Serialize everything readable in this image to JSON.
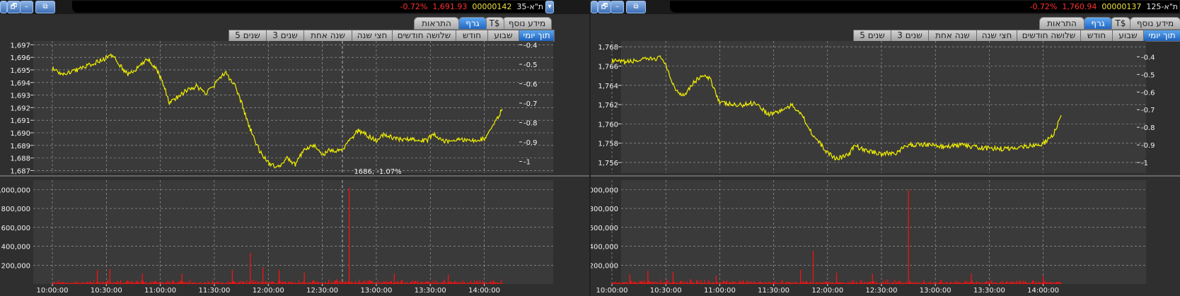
{
  "colors": {
    "line": "#f2f000",
    "volume": "#ff1010",
    "grid": "#a8a8a8",
    "activeTab": "#2f7fd8"
  },
  "panels": [
    {
      "window": {
        "minimize": "–",
        "restore": "🗗",
        "extra": "⯈"
      },
      "ticker": {
        "change": "-0.72%",
        "price": "1,691.93",
        "name": "ת\"א-35",
        "code": "00000142"
      },
      "tabs": [
        "מידע נוסף",
        "T$",
        "גרף",
        "התראות"
      ],
      "periods": [
        "תוך יומי",
        "שבוע",
        "חודש",
        "שלושה חודשים",
        "חצי שנה",
        "שנה אחת",
        "3 שנים",
        "5 שנים"
      ],
      "crosshair_label": "1686, -1.07%",
      "chart_data": {
        "type": "line",
        "x_ticks": [
          "10:00:00",
          "10:30:00",
          "11:00:00",
          "11:30:00",
          "12:00:00",
          "12:30:00",
          "13:00:00",
          "13:30:00",
          "14:00:00"
        ],
        "price_axis": {
          "ylim": [
            1686.8,
            1697.3
          ],
          "ticks": [
            "1,697",
            "1,696",
            "1,695",
            "1,694",
            "1,693",
            "1,692",
            "1,691",
            "1,690",
            "1,689",
            "1,688",
            "1,687"
          ]
        },
        "pct_axis": {
          "ylim": [
            -1.06,
            -0.38
          ],
          "ticks": [
            "-0.4",
            "-0.5",
            "-0.6",
            "-0.7",
            "-0.8",
            "-0.9",
            "-1"
          ]
        },
        "price_series": [
          {
            "t": "10:00",
            "v": 1695.1
          },
          {
            "t": "10:05",
            "v": 1694.6
          },
          {
            "t": "10:12",
            "v": 1694.9
          },
          {
            "t": "10:20",
            "v": 1695.4
          },
          {
            "t": "10:28",
            "v": 1695.8
          },
          {
            "t": "10:33",
            "v": 1696.2
          },
          {
            "t": "10:38",
            "v": 1695.3
          },
          {
            "t": "10:42",
            "v": 1694.6
          },
          {
            "t": "10:48",
            "v": 1695.2
          },
          {
            "t": "10:53",
            "v": 1695.9
          },
          {
            "t": "10:58",
            "v": 1695.0
          },
          {
            "t": "11:02",
            "v": 1693.8
          },
          {
            "t": "11:05",
            "v": 1692.3
          },
          {
            "t": "11:10",
            "v": 1692.9
          },
          {
            "t": "11:15",
            "v": 1693.4
          },
          {
            "t": "11:20",
            "v": 1693.7
          },
          {
            "t": "11:25",
            "v": 1693.1
          },
          {
            "t": "11:30",
            "v": 1693.8
          },
          {
            "t": "11:36",
            "v": 1694.8
          },
          {
            "t": "11:42",
            "v": 1693.6
          },
          {
            "t": "11:45",
            "v": 1692.4
          },
          {
            "t": "11:50",
            "v": 1690.3
          },
          {
            "t": "11:55",
            "v": 1688.6
          },
          {
            "t": "12:00",
            "v": 1687.6
          },
          {
            "t": "12:05",
            "v": 1687.2
          },
          {
            "t": "12:10",
            "v": 1688.0
          },
          {
            "t": "12:15",
            "v": 1687.5
          },
          {
            "t": "12:20",
            "v": 1688.7
          },
          {
            "t": "12:25",
            "v": 1689.1
          },
          {
            "t": "12:30",
            "v": 1688.2
          },
          {
            "t": "12:35",
            "v": 1688.7
          },
          {
            "t": "12:40",
            "v": 1688.5
          },
          {
            "t": "12:45",
            "v": 1689.3
          },
          {
            "t": "12:50",
            "v": 1690.2
          },
          {
            "t": "12:55",
            "v": 1689.8
          },
          {
            "t": "13:00",
            "v": 1689.4
          },
          {
            "t": "13:05",
            "v": 1689.9
          },
          {
            "t": "13:10",
            "v": 1689.5
          },
          {
            "t": "13:20",
            "v": 1689.5
          },
          {
            "t": "13:28",
            "v": 1689.4
          },
          {
            "t": "13:32",
            "v": 1689.9
          },
          {
            "t": "13:38",
            "v": 1689.3
          },
          {
            "t": "13:45",
            "v": 1689.4
          },
          {
            "t": "13:55",
            "v": 1689.4
          },
          {
            "t": "14:00",
            "v": 1689.5
          },
          {
            "t": "14:05",
            "v": 1690.5
          },
          {
            "t": "14:10",
            "v": 1691.9
          }
        ],
        "volume_axis": {
          "ylim": [
            0,
            1100000
          ],
          "ticks": [
            "1,000,000",
            "800,000",
            "600,000",
            "400,000",
            "200,000"
          ]
        },
        "volume_spikes": [
          {
            "t": "10:25",
            "v": 150000
          },
          {
            "t": "10:32",
            "v": 160000
          },
          {
            "t": "10:50",
            "v": 110000
          },
          {
            "t": "11:12",
            "v": 110000
          },
          {
            "t": "11:40",
            "v": 150000
          },
          {
            "t": "11:50",
            "v": 330000
          },
          {
            "t": "11:57",
            "v": 180000
          },
          {
            "t": "12:06",
            "v": 150000
          },
          {
            "t": "12:20",
            "v": 120000
          },
          {
            "t": "12:45",
            "v": 1020000
          },
          {
            "t": "13:10",
            "v": 110000
          },
          {
            "t": "13:40",
            "v": 100000
          }
        ]
      }
    },
    {
      "window": {
        "minimize": "–",
        "restore": "🗗",
        "extra": "⯈"
      },
      "ticker": {
        "change": "-0.72%",
        "price": "1,760.94",
        "name": "ת\"א-125",
        "code": "00000137"
      },
      "tabs": [
        "מידע נוסף",
        "T$",
        "גרף",
        "התראות"
      ],
      "periods": [
        "תוך יומי",
        "שבוע",
        "חודש",
        "שלושה חודשים",
        "חצי שנה",
        "שנה אחת",
        "3 שנים",
        "5 שנים"
      ],
      "crosshair_label": "",
      "chart_data": {
        "type": "line",
        "x_ticks": [
          "10:00:00",
          "10:30:00",
          "11:00:00",
          "11:30:00",
          "12:00:00",
          "12:30:00",
          "13:00:00",
          "13:30:00",
          "14:00:00"
        ],
        "price_axis": {
          "ylim": [
            1754.9,
            1768.6
          ],
          "ticks": [
            "1,768",
            "1,766",
            "1,764",
            "1,762",
            "1,760",
            "1,758",
            "1,756"
          ]
        },
        "pct_axis": {
          "ylim": [
            -1.06,
            -0.31
          ],
          "ticks": [
            "-0.4",
            "-0.5",
            "-0.6",
            "-0.7",
            "-0.8",
            "-0.9",
            "-1"
          ]
        },
        "price_series": [
          {
            "t": "10:00",
            "v": 1766.5
          },
          {
            "t": "10:08",
            "v": 1766.4
          },
          {
            "t": "10:15",
            "v": 1766.6
          },
          {
            "t": "10:25",
            "v": 1766.8
          },
          {
            "t": "10:28",
            "v": 1766.9
          },
          {
            "t": "10:32",
            "v": 1765.0
          },
          {
            "t": "10:36",
            "v": 1763.4
          },
          {
            "t": "10:40",
            "v": 1763.0
          },
          {
            "t": "10:45",
            "v": 1764.2
          },
          {
            "t": "10:50",
            "v": 1765.0
          },
          {
            "t": "10:55",
            "v": 1764.6
          },
          {
            "t": "11:00",
            "v": 1762.2
          },
          {
            "t": "11:10",
            "v": 1761.9
          },
          {
            "t": "11:20",
            "v": 1762.2
          },
          {
            "t": "11:27",
            "v": 1761.0
          },
          {
            "t": "11:33",
            "v": 1761.3
          },
          {
            "t": "11:40",
            "v": 1761.9
          },
          {
            "t": "11:45",
            "v": 1761.2
          },
          {
            "t": "11:52",
            "v": 1758.8
          },
          {
            "t": "12:00",
            "v": 1757.0
          },
          {
            "t": "12:05",
            "v": 1756.4
          },
          {
            "t": "12:12",
            "v": 1756.8
          },
          {
            "t": "12:15",
            "v": 1757.8
          },
          {
            "t": "12:20",
            "v": 1757.3
          },
          {
            "t": "12:30",
            "v": 1756.9
          },
          {
            "t": "12:38",
            "v": 1757.0
          },
          {
            "t": "12:45",
            "v": 1757.8
          },
          {
            "t": "12:55",
            "v": 1757.9
          },
          {
            "t": "13:05",
            "v": 1757.6
          },
          {
            "t": "13:15",
            "v": 1757.8
          },
          {
            "t": "13:25",
            "v": 1757.5
          },
          {
            "t": "13:40",
            "v": 1757.4
          },
          {
            "t": "13:50",
            "v": 1757.7
          },
          {
            "t": "14:00",
            "v": 1757.9
          },
          {
            "t": "14:06",
            "v": 1759.0
          },
          {
            "t": "14:10",
            "v": 1760.9
          }
        ],
        "volume_axis": {
          "ylim": [
            0,
            1100000
          ],
          "ticks": [
            "1,000,000",
            "800,000",
            "600,000",
            "400,000",
            "200,000"
          ]
        },
        "volume_spikes": [
          {
            "t": "10:10",
            "v": 100000
          },
          {
            "t": "10:20",
            "v": 140000
          },
          {
            "t": "10:34",
            "v": 130000
          },
          {
            "t": "10:58",
            "v": 90000
          },
          {
            "t": "11:45",
            "v": 150000
          },
          {
            "t": "11:52",
            "v": 350000
          },
          {
            "t": "12:05",
            "v": 120000
          },
          {
            "t": "12:25",
            "v": 110000
          },
          {
            "t": "12:45",
            "v": 1000000
          },
          {
            "t": "13:20",
            "v": 110000
          },
          {
            "t": "14:00",
            "v": 90000
          }
        ]
      }
    }
  ]
}
